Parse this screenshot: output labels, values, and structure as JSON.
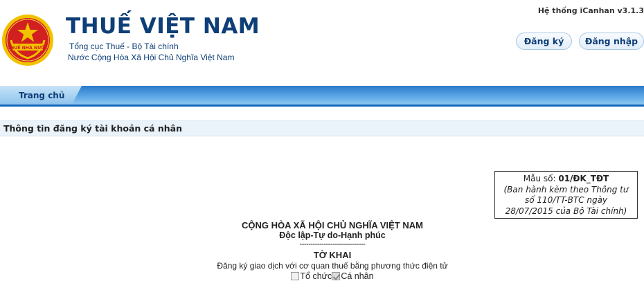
{
  "header": {
    "title": "THUẾ VIỆT NAM",
    "subtitle_1": "Tổng cục Thuế - Bộ Tài chính",
    "subtitle_2": "Nước Cộng Hòa Xã Hội Chủ Nghĩa Việt Nam",
    "logo_text": "THUẾ NHÀ NƯỚC",
    "system_version": "Hệ thống iCanhan v3.1.3",
    "register_label": "Đăng ký",
    "login_label": "Đăng nhập"
  },
  "nav": {
    "home_label": "Trang chủ"
  },
  "section": {
    "title": "Thông tin đăng ký tài khoản cá nhân"
  },
  "form": {
    "form_no_label": "Mẫu số: ",
    "form_no_code": "01/ĐK_TĐT",
    "form_note_1": "(Ban hành kèm theo Thông tư",
    "form_note_2": "số 110/TT-BTC ngày",
    "form_note_3": "28/07/2015 của Bộ Tài chính)",
    "republic": "CỘNG HÒA XÃ HỘI CHỦ NGHĨA VIỆT NAM",
    "motto": "Độc lập-Tự do-Hạnh phúc",
    "separator": "------------------------------",
    "declaration_title": "TỜ KHAI",
    "declaration_desc": "Đăng ký giao dịch với cơ quan thuế bằng phương thức điện tử",
    "option_org": "Tổ chức",
    "option_individual": "Cá nhân",
    "option_org_checked": false,
    "option_individual_checked": true
  },
  "colors": {
    "brand": "#0d3e77",
    "nav_blue": "#2a79c9",
    "emblem_red": "#d21f1f",
    "emblem_gold": "#f2c200"
  }
}
